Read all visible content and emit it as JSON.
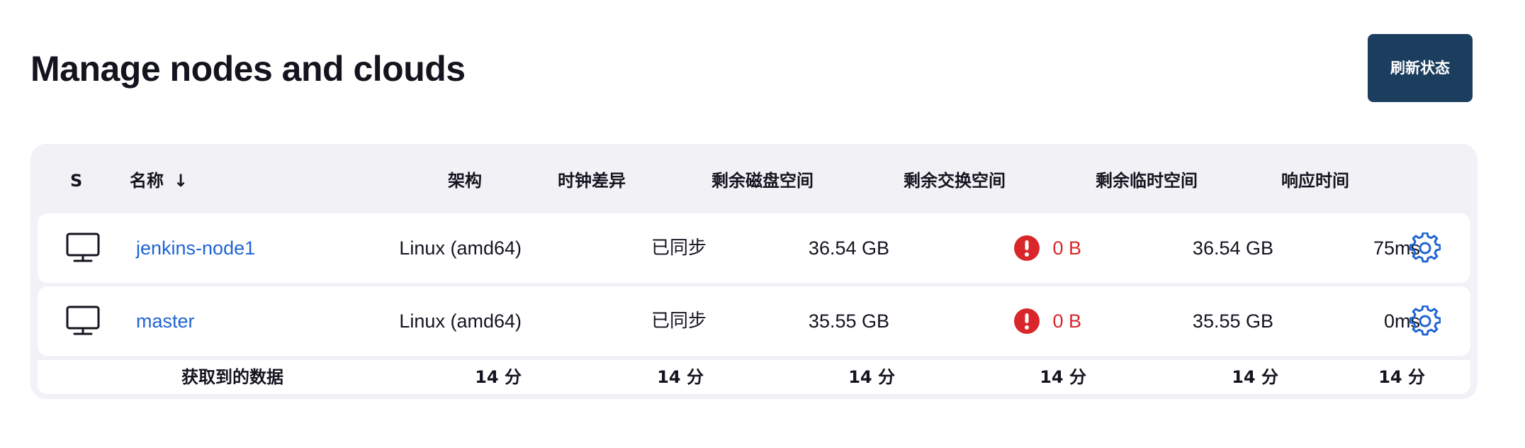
{
  "header": {
    "title": "Manage nodes and clouds",
    "refresh_label": "刷新状态"
  },
  "colors": {
    "accent": "#1b3d5e",
    "link": "#1f64d3",
    "warning": "#d9262a",
    "card_bg": "#f2f2f6"
  },
  "table": {
    "columns": {
      "status": "S",
      "name": "名称",
      "name_sort": "↓",
      "arch": "架构",
      "clock": "时钟差异",
      "disk": "剩余磁盘空间",
      "swap": "剩余交换空间",
      "temp": "剩余临时空间",
      "response": "响应时间"
    },
    "rows": [
      {
        "icon": "computer-icon",
        "name": "jenkins-node1",
        "arch": "Linux (amd64)",
        "clock": "已同步",
        "disk": "36.54 GB",
        "swap": "0 B",
        "swap_warning": true,
        "temp": "36.54 GB",
        "response": "75ms"
      },
      {
        "icon": "computer-icon",
        "name": "master",
        "arch": "Linux (amd64)",
        "clock": "已同步",
        "disk": "35.55 GB",
        "swap": "0 B",
        "swap_warning": true,
        "temp": "35.55 GB",
        "response": "0ms"
      }
    ],
    "footer": {
      "label": "获取到的数据",
      "arch": "14 分",
      "clock": "14 分",
      "disk": "14 分",
      "swap": "14 分",
      "temp": "14 分",
      "response": "14 分"
    }
  }
}
